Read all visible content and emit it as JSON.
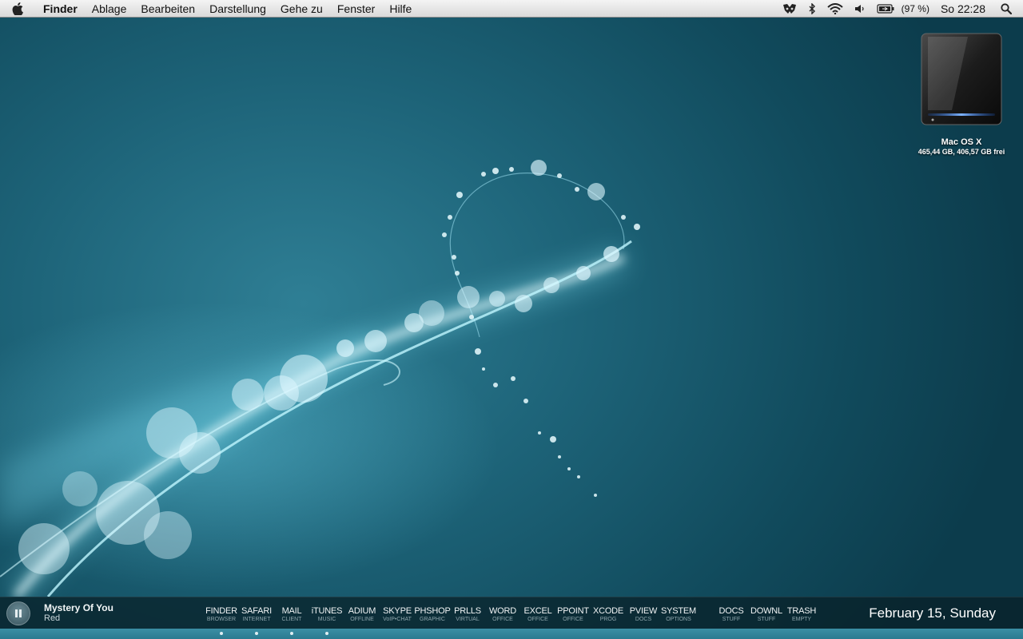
{
  "menubar": {
    "app_name": "Finder",
    "menus": [
      "Ablage",
      "Bearbeiten",
      "Darstellung",
      "Gehe zu",
      "Fenster",
      "Hilfe"
    ],
    "battery_percent": "(97 %)",
    "clock": "So 22:28",
    "status_icons": [
      "growl-icon",
      "bluetooth-icon",
      "wifi-icon",
      "volume-icon",
      "battery-icon",
      "spotlight-icon"
    ]
  },
  "desktop": {
    "disk": {
      "name": "Mac OS X",
      "info": "465,44 GB, 406,57 GB frei"
    }
  },
  "player": {
    "title": "Mystery Of You",
    "artist": "Red",
    "state_icon": "pause-icon"
  },
  "dock": {
    "items": [
      {
        "label": "FINDER",
        "sub": "BROWSER",
        "running": true
      },
      {
        "label": "SAFARI",
        "sub": "INTERNET",
        "running": true
      },
      {
        "label": "MAIL",
        "sub": "CLIENT",
        "running": true
      },
      {
        "label": "iTUNES",
        "sub": "MUSIC",
        "running": true
      },
      {
        "label": "ADIUM",
        "sub": "OFFLINE",
        "running": false
      },
      {
        "label": "SKYPE",
        "sub": "VoIP•CHAT",
        "running": false
      },
      {
        "label": "PHSHOP",
        "sub": "GRAPHIC",
        "running": false
      },
      {
        "label": "PRLLS",
        "sub": "VIRTUAL",
        "running": false
      },
      {
        "label": "WORD",
        "sub": "OFFICE",
        "running": false
      },
      {
        "label": "EXCEL",
        "sub": "OFFICE",
        "running": false
      },
      {
        "label": "PPOINT",
        "sub": "OFFICE",
        "running": false
      },
      {
        "label": "XCODE",
        "sub": "PROG",
        "running": false
      },
      {
        "label": "PVIEW",
        "sub": "DOCS",
        "running": false
      },
      {
        "label": "SYSTEM",
        "sub": "OPTIONS",
        "running": false
      },
      {
        "label": "DOCS",
        "sub": "STUFF",
        "running": false
      },
      {
        "label": "DOWNL",
        "sub": "STUFF",
        "running": false
      },
      {
        "label": "TRASH",
        "sub": "EMPTY",
        "running": false
      }
    ]
  },
  "date": "February 15, Sunday"
}
